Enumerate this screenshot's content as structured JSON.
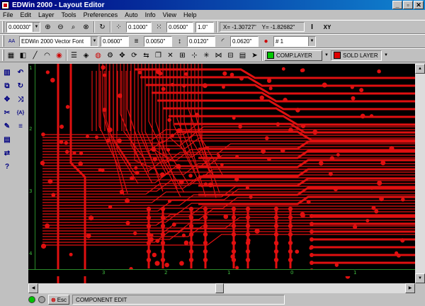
{
  "window": {
    "title": "EDWin 2000 - Layout Editor",
    "buttons": [
      "_",
      "▫",
      "✕"
    ]
  },
  "menu": [
    "File",
    "Edit",
    "Layer",
    "Tools",
    "Preferences",
    "Auto",
    "Info",
    "View",
    "Help"
  ],
  "toolbar1": {
    "grid_value": "0.00030\"",
    "snap_value": "0.1000\"",
    "spacing_value": "0.0500\"",
    "zoom_value": "1.0\"",
    "x_coord": "X= -1.30727\"",
    "y_coord": "Y= -1.82682\"",
    "mode_label": "I",
    "xy_label": "XY"
  },
  "toolbar2": {
    "font": "EDWin 2000 Vector Font",
    "text_height": "0.0600\"",
    "line_width": "0.0050\"",
    "via_size": "0.0120\"",
    "arc_value": "0.0620\"",
    "pad_select": "# 1"
  },
  "layers": [
    {
      "label": "COMP.LAYER",
      "color": "#00c800"
    },
    {
      "label": "SOLD LAYER",
      "color": "#e00000"
    }
  ],
  "ruler": {
    "vertical_labels": [
      "1",
      "2",
      "3",
      "4"
    ],
    "horizontal_labels": [
      "3",
      "2",
      "1",
      "0",
      "1"
    ]
  },
  "status": {
    "esc_label": "Esc",
    "mode": "COMPONENT EDIT"
  },
  "colors": {
    "trace": "#e01010",
    "canvas": "#000000",
    "ruler": "#3fbf3f"
  }
}
